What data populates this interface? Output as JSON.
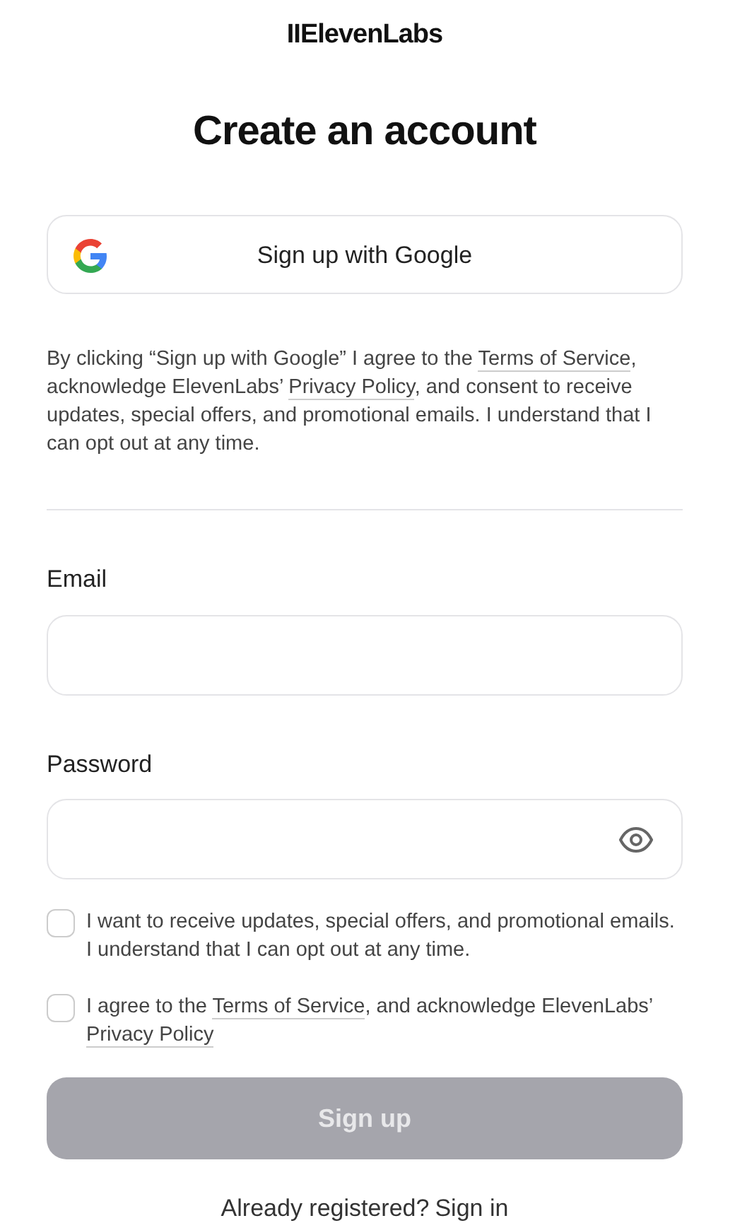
{
  "logo": "IIElevenLabs",
  "title": "Create an account",
  "google_button": {
    "label": "Sign up with Google"
  },
  "consent_text": [
    {
      "kind": "text",
      "text": "By clicking “Sign up with Google” I agree to the "
    },
    {
      "kind": "link",
      "text": "Terms of Service"
    },
    {
      "kind": "text",
      "text": ", acknowledge ElevenLabs’ "
    },
    {
      "kind": "link",
      "text": "Privacy Policy"
    },
    {
      "kind": "text",
      "text": ", and consent to receive updates, special offers, and promotional emails. I understand that I can opt out at any time."
    }
  ],
  "fields": [
    {
      "kind": "email",
      "label": "Email"
    },
    {
      "kind": "password",
      "label": "Password"
    }
  ],
  "checkboxes": [
    {
      "checked": false,
      "parts": [
        {
          "kind": "text",
          "text": "I want to receive updates, special offers, and promotional emails. I understand that I can opt out at any time."
        }
      ]
    },
    {
      "checked": false,
      "parts": [
        {
          "kind": "text",
          "text": "I agree to the "
        },
        {
          "kind": "link",
          "text": "Terms of Service"
        },
        {
          "kind": "text",
          "text": ", and acknowledge ElevenLabs’ "
        },
        {
          "kind": "link",
          "text": "Privacy Policy"
        }
      ]
    }
  ],
  "submit": {
    "label": "Sign up",
    "disabled": true
  },
  "footer": {
    "text": "Already registered?",
    "link": "Sign in"
  }
}
